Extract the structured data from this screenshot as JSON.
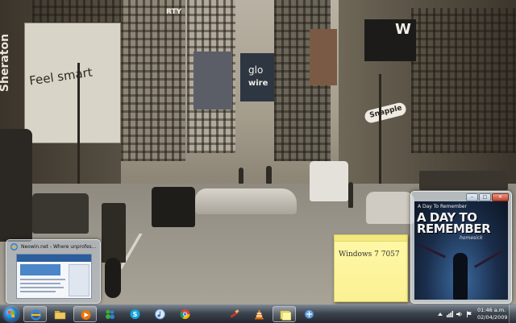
{
  "desktop": {
    "wallpaper_signs": {
      "sheraton": "Sheraton",
      "feel_smart": "Feel smart",
      "arty": "RTY",
      "w": "W",
      "glo": "glo",
      "wire": "wire",
      "snapple": "Snapple"
    }
  },
  "sticky_note": {
    "text": "Windows 7 7057"
  },
  "media_window": {
    "caption": "A Day To Remember",
    "album_title": "A Day To Remember",
    "album_subtitle": "homesick"
  },
  "preview": {
    "title": "Neowin.net - Where unprofessi..."
  },
  "taskbar": {
    "apps": [
      {
        "name": "internet-explorer",
        "active": true
      },
      {
        "name": "windows-explorer",
        "active": false
      },
      {
        "name": "media-player",
        "active": true
      },
      {
        "name": "windows-live-messenger",
        "active": false
      },
      {
        "name": "skype",
        "active": false
      },
      {
        "name": "itunes",
        "active": false
      },
      {
        "name": "google-chrome",
        "active": false
      },
      {
        "name": "paint",
        "active": false
      },
      {
        "name": "vlc",
        "active": false
      },
      {
        "name": "sticky-notes",
        "active": true
      },
      {
        "name": "other-app",
        "active": false
      }
    ],
    "clock_time": "01:46 a.m.",
    "clock_date": "02/04/2009"
  }
}
